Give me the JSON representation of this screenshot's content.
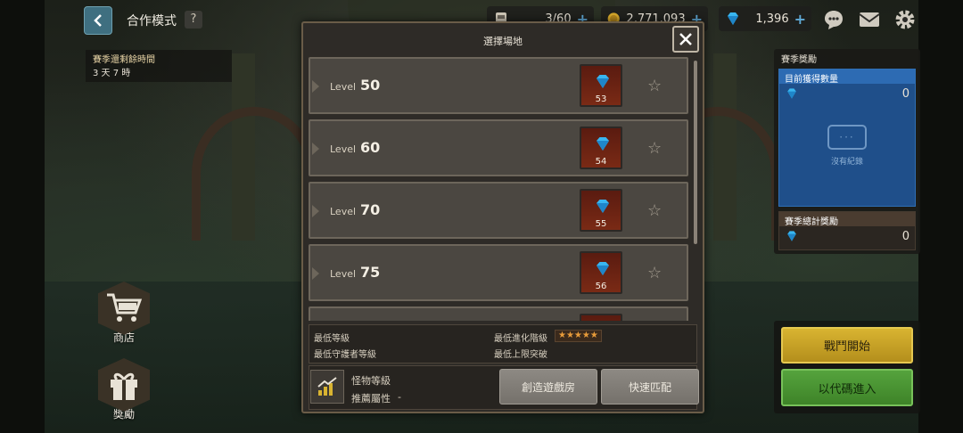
{
  "header": {
    "title": "合作模式",
    "help_label": "?",
    "currencies": [
      {
        "icon": "fuel-icon",
        "value": "3/60"
      },
      {
        "icon": "gold-icon",
        "value": "2,771,093"
      },
      {
        "icon": "gem-icon",
        "value": "1,396"
      }
    ],
    "plus_label": "+"
  },
  "season_timer": {
    "label": "賽季還剩餘時間",
    "value": "3 天 7 時"
  },
  "side_buttons": [
    {
      "label": "商店",
      "icon": "cart-icon"
    },
    {
      "label": "獎勵",
      "icon": "gift-icon"
    }
  ],
  "modal": {
    "title": "選擇場地",
    "level_prefix": "Level",
    "levels": [
      {
        "level": "50",
        "gems": "53"
      },
      {
        "level": "60",
        "gems": "54"
      },
      {
        "level": "70",
        "gems": "55"
      },
      {
        "level": "75",
        "gems": "56"
      }
    ],
    "requirements": {
      "min_level": "最低等級",
      "min_guardian_level": "最低守護者等級",
      "min_evolution_tier": "最低進化階級",
      "min_limit_break": "最低上限突破",
      "stars": "★★★★★"
    },
    "monster": {
      "level_label": "怪物等級",
      "attribute_label": "推薦屬性",
      "attribute_value": "-"
    },
    "create_room_label": "創造遊戲房",
    "quick_match_label": "快速匹配"
  },
  "season_rewards": {
    "title": "賽季獎勵",
    "current_label": "目前獲得數量",
    "current_value": "0",
    "no_record": "沒有紀錄",
    "no_record_dots": "···",
    "total_label": "賽季總計獎勵",
    "total_value": "0"
  },
  "actions": {
    "battle_start": "戰鬥開始",
    "enter_code": "以代碼進入"
  },
  "colors": {
    "accent_gold": "#d9b431",
    "accent_green": "#55a33d",
    "reward_blue": "#1f4f8a",
    "gem_blue": "#39b6f0"
  }
}
